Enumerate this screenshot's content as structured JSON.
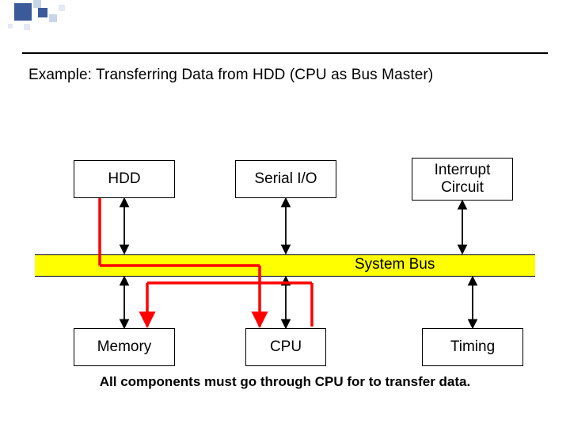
{
  "title": "Example: Transferring Data from HDD (CPU as Bus Master)",
  "nodes": {
    "hdd": "HDD",
    "serial": "Serial I/O",
    "interrupt": "Interrupt\nCircuit",
    "memory": "Memory",
    "cpu": "CPU",
    "timing": "Timing"
  },
  "bus_label": "System Bus",
  "caption": "All components must go through CPU for to transfer data.",
  "colors": {
    "bus": "#ffff00",
    "highlight": "#ff0000",
    "line": "#000000"
  }
}
